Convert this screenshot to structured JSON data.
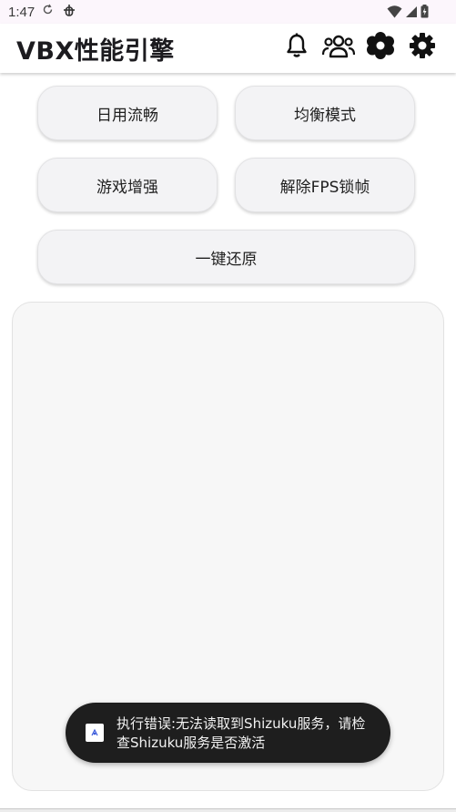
{
  "status_bar": {
    "time": "1:47",
    "sync_icon": "sync-icon",
    "debug_icon": "bug-icon"
  },
  "app_bar": {
    "title": "VBX性能引擎",
    "actions": [
      {
        "name": "bell-icon"
      },
      {
        "name": "group-icon"
      },
      {
        "name": "flower-settings-icon"
      },
      {
        "name": "gear-icon"
      }
    ]
  },
  "modes": {
    "daily_smooth": "日用流畅",
    "balanced": "均衡模式",
    "game_boost": "游戏增强",
    "unlock_fps": "解除FPS锁帧",
    "restore": "一键还原"
  },
  "output": {
    "content": ""
  },
  "toast": {
    "message": "执行错误:无法读取到Shizuku服务，请检查Shizuku服务是否激活"
  },
  "colors": {
    "button_bg": "#f3f3f5",
    "panel_bg": "#f7f7f7",
    "toast_bg": "#1e1e1e",
    "status_bar_bg": "#fcf6fc"
  }
}
